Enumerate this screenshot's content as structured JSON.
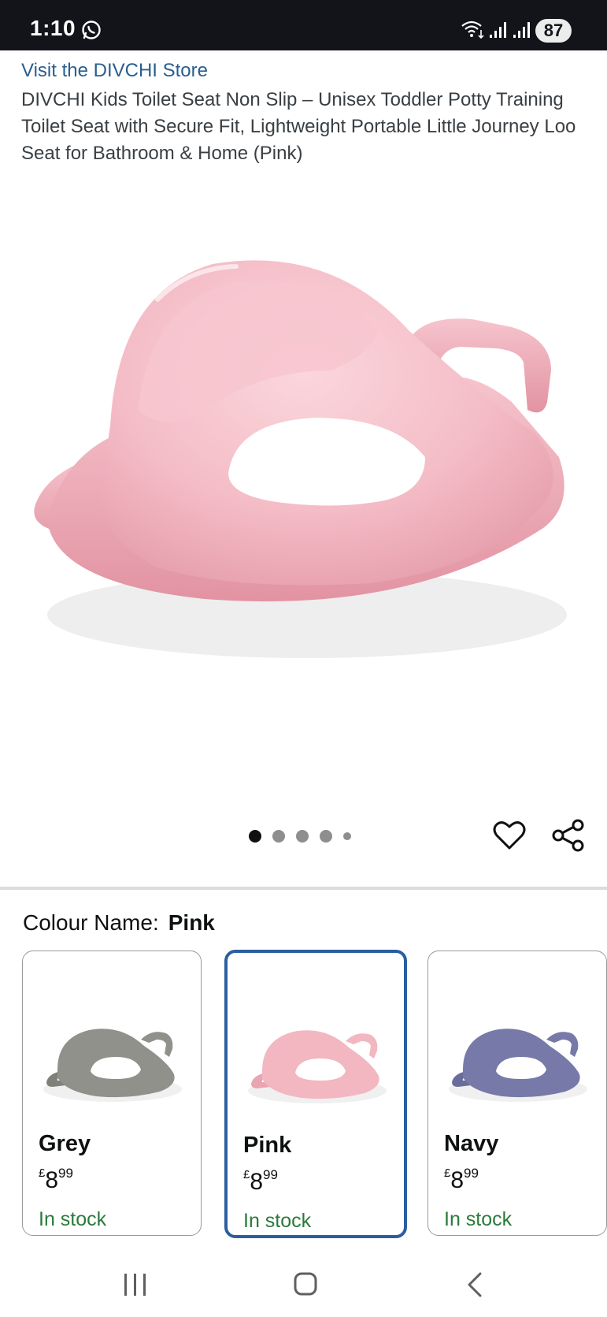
{
  "status_bar": {
    "time": "1:10",
    "battery": "87",
    "icons": [
      "whatsapp-icon",
      "wifi-icon",
      "signal-icon",
      "signal-icon",
      "battery-icon"
    ]
  },
  "store_link": "Visit the DIVCHI Store",
  "product_title": "DIVCHI Kids Toilet Seat Non Slip – Unisex Toddler Potty Training Toilet Seat with Secure Fit, Lightweight Portable Little Journey Loo Seat for Bathroom & Home (Pink)",
  "gallery": {
    "image_count": 5,
    "active_index": 0,
    "icons": [
      "heart-icon",
      "share-icon"
    ]
  },
  "colour": {
    "label": "Colour Name:",
    "selected": "Pink"
  },
  "swatches": [
    {
      "name": "Grey",
      "currency": "£",
      "whole": "8",
      "fraction": "99",
      "stock": "In stock",
      "color": "#8f918a",
      "selected": false
    },
    {
      "name": "Pink",
      "currency": "£",
      "whole": "8",
      "fraction": "99",
      "stock": "In stock",
      "color": "#f2b7c1",
      "selected": true
    },
    {
      "name": "Navy",
      "currency": "£",
      "whole": "8",
      "fraction": "99",
      "stock": "In stock",
      "color": "#7779a8",
      "selected": false
    }
  ],
  "nav_bar": {
    "icons": [
      "recents-icon",
      "home-icon",
      "back-icon"
    ]
  },
  "colors": {
    "link": "#2a5e8f",
    "stock": "#2b7a3b",
    "selected_border": "#2a5ea0",
    "product_pink": "#f2b7c1"
  }
}
